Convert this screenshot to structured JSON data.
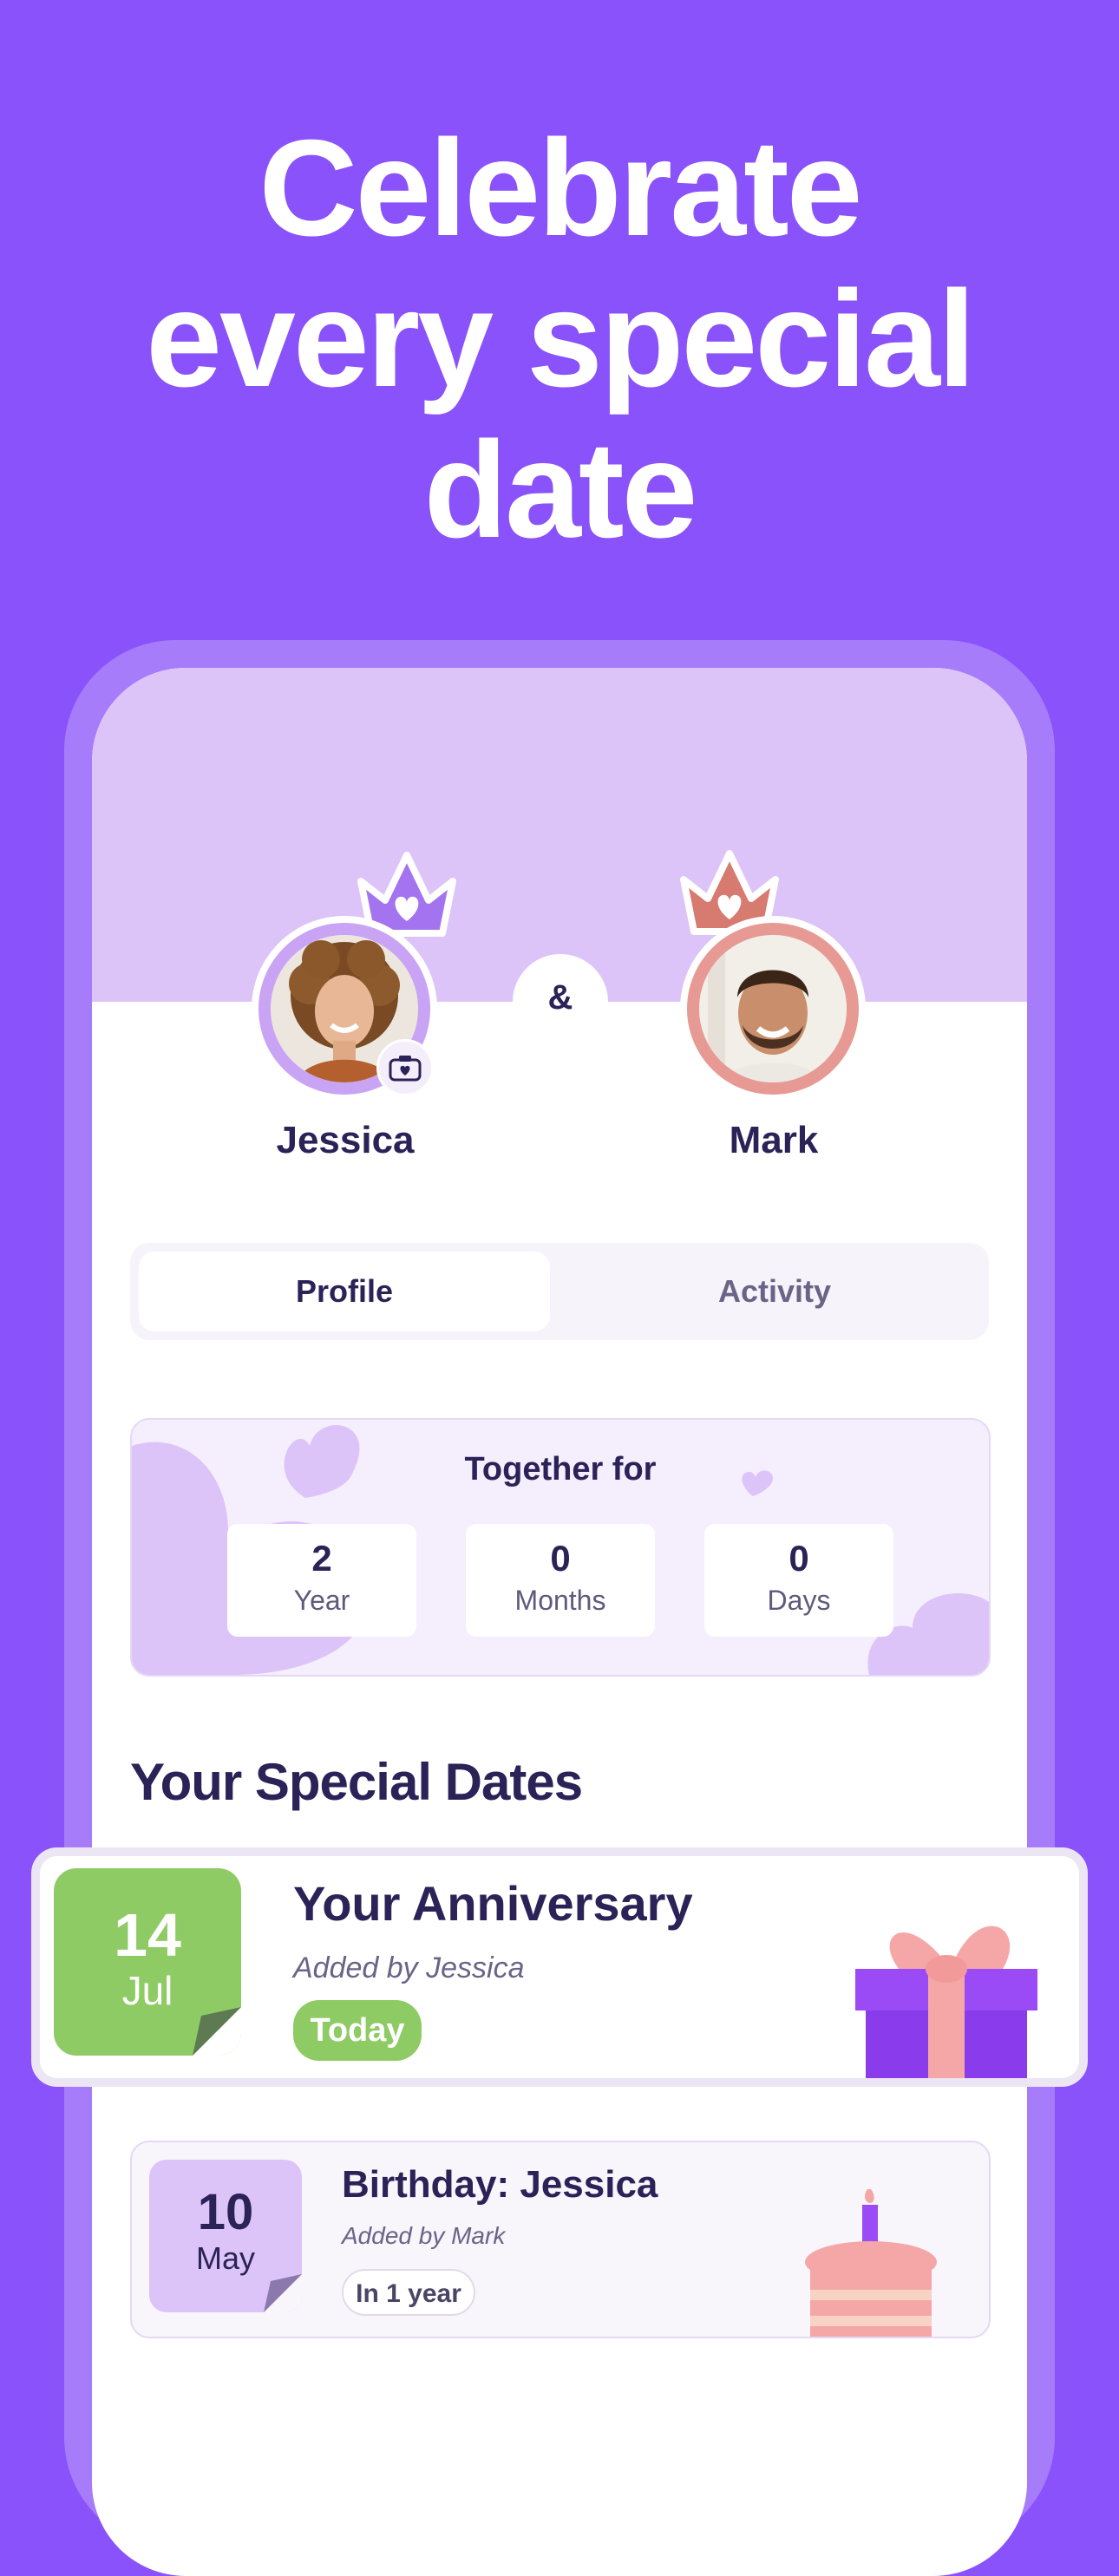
{
  "headline": "Celebrate\nevery special\ndate",
  "couple": {
    "ampersand": "&",
    "person1": {
      "name": "Jessica"
    },
    "person2": {
      "name": "Mark"
    }
  },
  "tabs": {
    "profile": "Profile",
    "activity": "Activity"
  },
  "together": {
    "title": "Together for",
    "stats": [
      {
        "value": "2",
        "label": "Year"
      },
      {
        "value": "0",
        "label": "Months"
      },
      {
        "value": "0",
        "label": "Days"
      }
    ]
  },
  "special_dates": {
    "title": "Your Special Dates",
    "items": [
      {
        "day": "14",
        "month": "Jul",
        "title": "Your Anniversary",
        "added_by": "Added by Jessica",
        "badge": "Today",
        "icon": "gift-icon"
      },
      {
        "day": "10",
        "month": "May",
        "title": "Birthday: Jessica",
        "added_by": "Added by Mark",
        "badge": "In 1 year",
        "icon": "cake-icon"
      }
    ]
  },
  "colors": {
    "background": "#8a52fb",
    "accent_lilac": "#dcc4f9",
    "green": "#8fcb64",
    "navy": "#2b2257"
  }
}
